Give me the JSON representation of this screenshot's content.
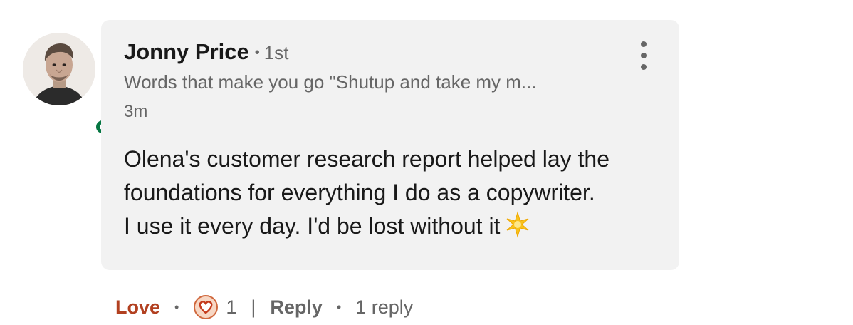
{
  "comment": {
    "author": {
      "name": "Jonny Price",
      "degree": "1st",
      "headline": "Words that make you go \"Shutup and take my m...",
      "online_status_color": "#057642"
    },
    "timestamp": "3m",
    "body_lines": [
      "Olena's customer research report helped lay the",
      "foundations for everything I do as a copywriter.",
      "I use it every day. I'd be lost without it"
    ],
    "body_emoji": "sparkle-icon",
    "menu_icon": "more-vertical-icon",
    "bubble_color": "#f2f2f2"
  },
  "actions": {
    "reaction_label": "Love",
    "reaction_color": "#b24020",
    "reaction_icon": "heart-icon",
    "reaction_count": "1",
    "separator": "|",
    "reply_label": "Reply",
    "replies_text": "1 reply"
  }
}
